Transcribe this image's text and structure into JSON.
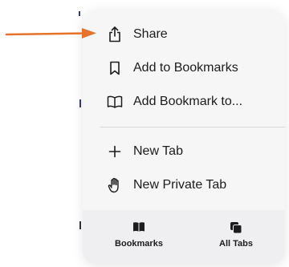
{
  "menu": {
    "items": [
      {
        "label": "Share",
        "icon": "share-icon"
      },
      {
        "label": "Add to Bookmarks",
        "icon": "bookmark-icon"
      },
      {
        "label": "Add Bookmark to...",
        "icon": "book-icon"
      },
      {
        "label": "New Tab",
        "icon": "plus-icon"
      },
      {
        "label": "New Private Tab",
        "icon": "hand-icon"
      }
    ]
  },
  "toolbar": {
    "bookmarks_label": "Bookmarks",
    "all_tabs_label": "All Tabs"
  },
  "colors": {
    "arrow": "#e8722a",
    "menu_bg": "#f6f6f6",
    "text": "#1c1c1e"
  }
}
